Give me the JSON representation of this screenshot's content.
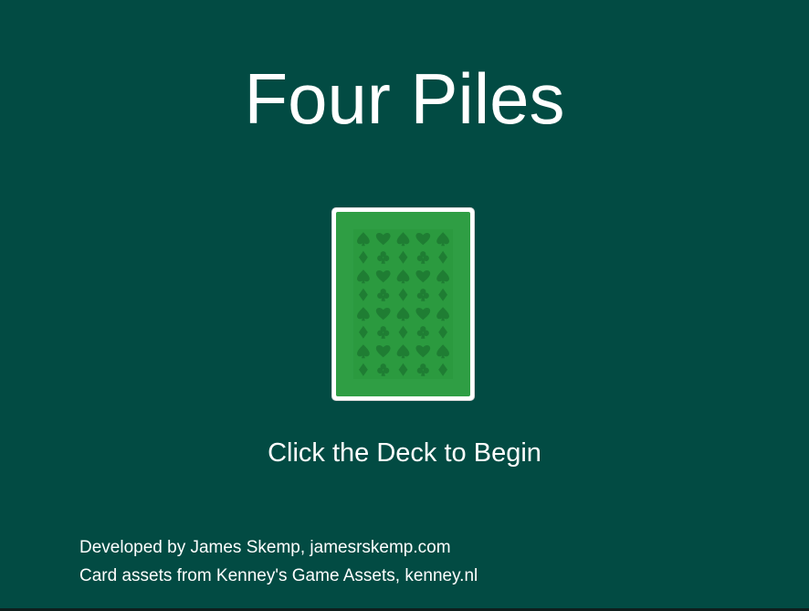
{
  "game": {
    "title": "Four Piles",
    "prompt": "Click the Deck to Begin"
  },
  "deck": {
    "label": "deck",
    "back_pattern_rows": [
      [
        "spade",
        "heart",
        "spade",
        "heart",
        "spade"
      ],
      [
        "diamond",
        "club",
        "diamond",
        "club",
        "diamond"
      ],
      [
        "spade",
        "heart",
        "spade",
        "heart",
        "spade"
      ],
      [
        "diamond",
        "club",
        "diamond",
        "club",
        "diamond"
      ],
      [
        "spade",
        "heart",
        "spade",
        "heart",
        "spade"
      ],
      [
        "diamond",
        "club",
        "diamond",
        "club",
        "diamond"
      ],
      [
        "spade",
        "heart",
        "spade",
        "heart",
        "spade"
      ],
      [
        "diamond",
        "club",
        "diamond",
        "club",
        "diamond"
      ]
    ]
  },
  "credits": {
    "line1": "Developed by James Skemp, jamesrskemp.com",
    "line2": "Card assets from Kenney's Game Assets, kenney.nl"
  },
  "colors": {
    "background": "#024b43",
    "card_back": "#2f9e44",
    "card_symbols": "#1f7d33",
    "text": "#ffffff"
  }
}
